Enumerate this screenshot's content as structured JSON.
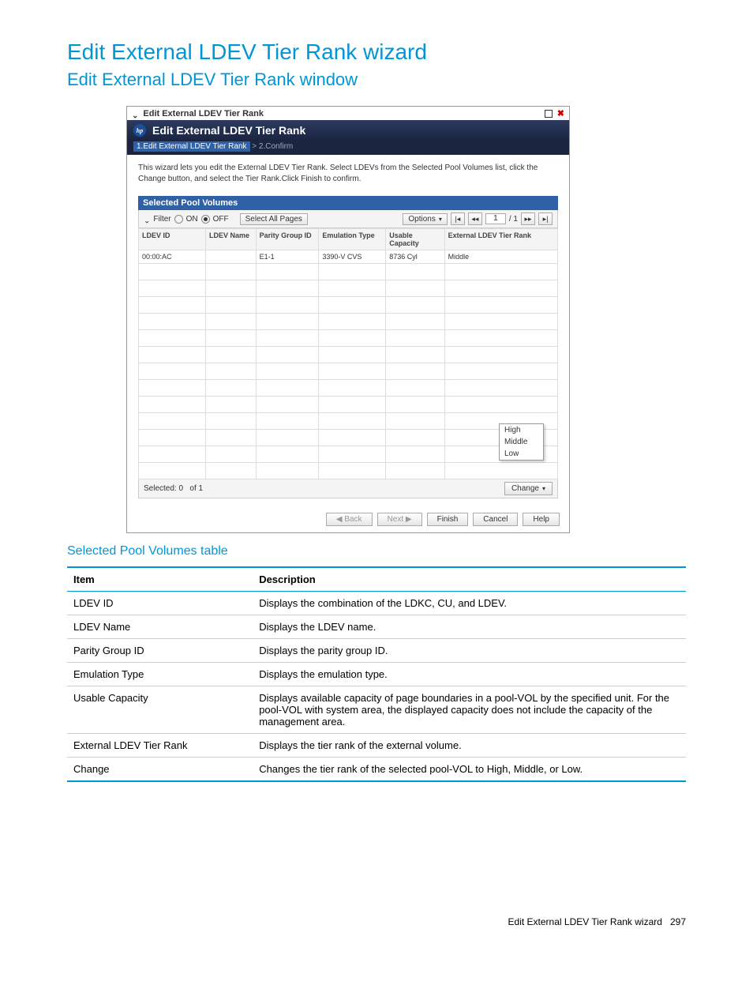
{
  "doc": {
    "h1": "Edit External LDEV Tier Rank wizard",
    "h2": "Edit External LDEV Tier Rank window",
    "h3": "Selected Pool Volumes table",
    "footer_label": "Edit External LDEV Tier Rank wizard",
    "footer_page": "297"
  },
  "wizard": {
    "titlebar": "Edit External LDEV Tier Rank",
    "header": "Edit External LDEV Tier Rank",
    "breadcrumb_step1": "1.Edit External LDEV Tier Rank",
    "breadcrumb_sep": ">",
    "breadcrumb_step2": "2.Confirm",
    "instructions": "This wizard lets you edit the External LDEV Tier Rank. Select LDEVs from the Selected Pool Volumes list, click the Change button, and select the Tier Rank.Click Finish to confirm.",
    "panel_title": "Selected Pool Volumes",
    "toolbar": {
      "filter_label": "Filter",
      "on_label": "ON",
      "off_label": "OFF",
      "select_all": "Select All Pages",
      "options": "Options",
      "page_current": "1",
      "page_total": "/ 1"
    },
    "columns": [
      "LDEV ID",
      "LDEV Name",
      "Parity Group ID",
      "Emulation Type",
      "Usable Capacity",
      "External LDEV Tier Rank"
    ],
    "rows": [
      {
        "ldev_id": "00:00:AC",
        "ldev_name": "",
        "pg_id": "E1-1",
        "emu": "3390-V CVS",
        "cap": "8736 Cyl",
        "rank": "Middle"
      }
    ],
    "rank_options": [
      "High",
      "Middle",
      "Low"
    ],
    "footer": {
      "selected_label": "Selected:",
      "selected": "0",
      "of_label": "of",
      "total": "1",
      "change": "Change"
    },
    "buttons": {
      "back": "Back",
      "next": "Next",
      "finish": "Finish",
      "cancel": "Cancel",
      "help": "Help"
    }
  },
  "desc_table": {
    "headers": [
      "Item",
      "Description"
    ],
    "rows": [
      {
        "item": "LDEV ID",
        "desc": "Displays the combination of the LDKC, CU, and LDEV."
      },
      {
        "item": "LDEV Name",
        "desc": "Displays the LDEV name."
      },
      {
        "item": "Parity Group ID",
        "desc": "Displays the parity group ID."
      },
      {
        "item": "Emulation Type",
        "desc": "Displays the emulation type."
      },
      {
        "item": "Usable Capacity",
        "desc": "Displays available capacity of page boundaries in a pool-VOL by the specified unit. For the pool-VOL with system area, the displayed capacity does not include the capacity of the management area."
      },
      {
        "item": "External LDEV Tier Rank",
        "desc": "Displays the tier rank of the external volume."
      },
      {
        "item": "Change",
        "desc": "Changes the tier rank of the selected pool-VOL to High, Middle, or Low."
      }
    ]
  }
}
